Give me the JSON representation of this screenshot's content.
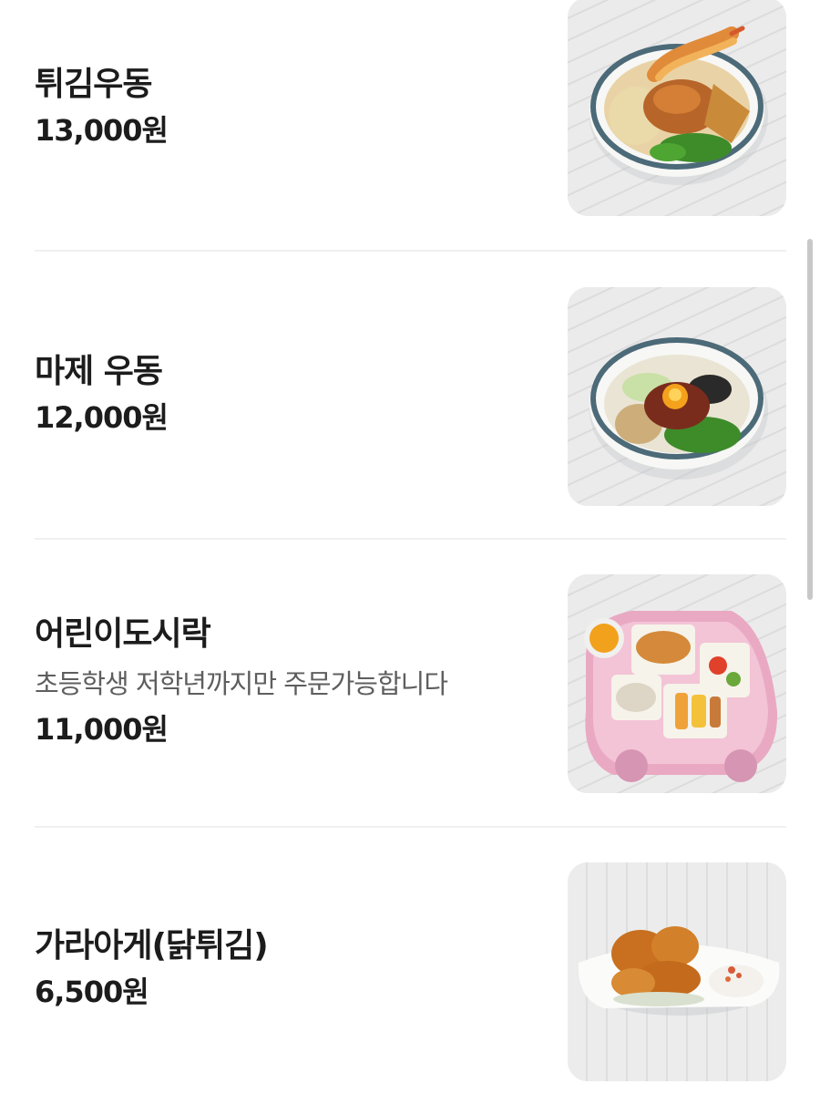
{
  "menu": {
    "items": [
      {
        "name": "튀김우동",
        "description": "",
        "price": "13,000원",
        "image_icon": "tempura-udon-photo"
      },
      {
        "name": "마제 우동",
        "description": "",
        "price": "12,000원",
        "image_icon": "maze-udon-photo"
      },
      {
        "name": "어린이도시락",
        "description": "초등학생 저학년까지만 주문가능합니다",
        "price": "11,000원",
        "image_icon": "kids-lunchbox-photo"
      },
      {
        "name": "가라아게(닭튀김)",
        "description": "",
        "price": "6,500원",
        "image_icon": "karaage-photo"
      }
    ]
  },
  "colors": {
    "text_primary": "#1c1c1c",
    "text_secondary": "#5e5e5e",
    "divider": "#f0f0f0",
    "scrollbar": "#c8c8c8"
  }
}
